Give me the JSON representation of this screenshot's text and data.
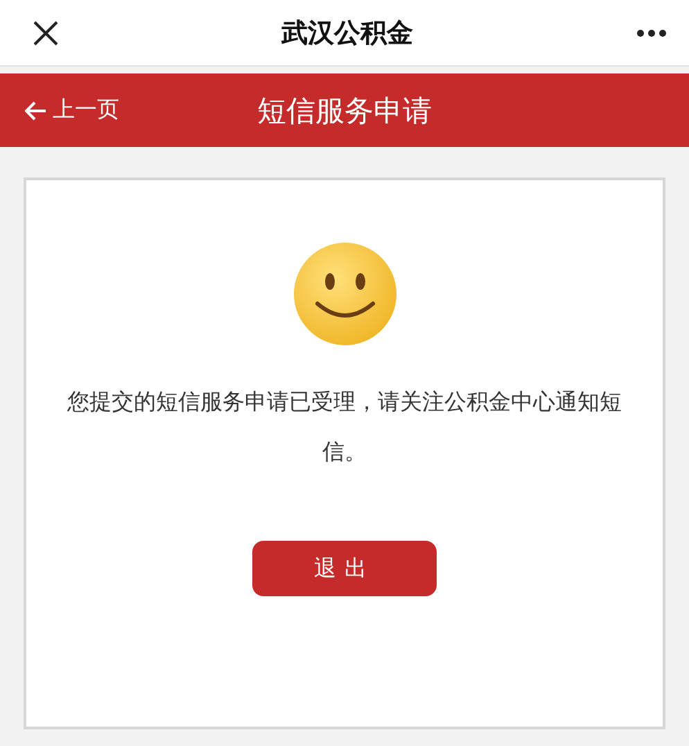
{
  "window": {
    "title": "武汉公积金"
  },
  "nav": {
    "back": "上一页",
    "title": "短信服务申请"
  },
  "result": {
    "message": "您提交的短信服务申请已受理，请关注公积金中心通知短信。",
    "button": "退出"
  }
}
